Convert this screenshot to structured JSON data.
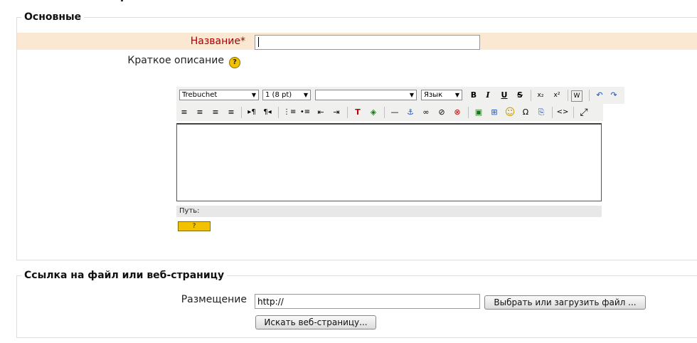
{
  "sections": {
    "general": {
      "legend": "Основные"
    },
    "link": {
      "legend": "Ссылка на файл или веб-страницу"
    }
  },
  "form": {
    "name_label": "Название",
    "required_mark": "*",
    "name_value": "",
    "summary_label": "Краткое описание",
    "location_label": "Размещение",
    "location_value": "http://"
  },
  "editor": {
    "font_family": "Trebuchet",
    "font_size": "1 (8 pt)",
    "heading": "",
    "language": "Язык",
    "path_label": "Путь:",
    "toolbar1": [
      {
        "name": "bold-icon",
        "glyph": "B"
      },
      {
        "name": "italic-icon",
        "glyph": "I"
      },
      {
        "name": "underline-icon",
        "glyph": "U"
      },
      {
        "name": "strikethrough-icon",
        "glyph": "S"
      },
      {
        "name": "subscript-icon",
        "glyph": "x₂"
      },
      {
        "name": "superscript-icon",
        "glyph": "x²"
      },
      {
        "name": "paste-word-icon",
        "glyph": "W"
      },
      {
        "name": "undo-icon",
        "glyph": "↶"
      },
      {
        "name": "redo-icon",
        "glyph": "↷"
      }
    ],
    "toolbar2": [
      {
        "name": "align-left-icon",
        "glyph": "≡"
      },
      {
        "name": "align-center-icon",
        "glyph": "≡"
      },
      {
        "name": "align-right-icon",
        "glyph": "≡"
      },
      {
        "name": "justify-icon",
        "glyph": "≡"
      },
      {
        "name": "ltr-icon",
        "glyph": "▸¶"
      },
      {
        "name": "rtl-icon",
        "glyph": "¶◂"
      },
      {
        "name": "ordered-list-icon",
        "glyph": "⋮≡"
      },
      {
        "name": "unordered-list-icon",
        "glyph": "•≡"
      },
      {
        "name": "outdent-icon",
        "glyph": "⇤"
      },
      {
        "name": "indent-icon",
        "glyph": "⇥"
      },
      {
        "name": "text-color-icon",
        "glyph": "T"
      },
      {
        "name": "bg-color-icon",
        "glyph": "◈"
      },
      {
        "name": "horizontal-rule-icon",
        "glyph": "—"
      },
      {
        "name": "anchor-icon",
        "glyph": "⚓"
      },
      {
        "name": "link-icon",
        "glyph": "∞"
      },
      {
        "name": "unlink-icon",
        "glyph": "⊘"
      },
      {
        "name": "nolink-icon",
        "glyph": "⊗"
      },
      {
        "name": "image-icon",
        "glyph": "▣"
      },
      {
        "name": "table-icon",
        "glyph": "⊞"
      },
      {
        "name": "smiley-icon",
        "glyph": "☺"
      },
      {
        "name": "special-char-icon",
        "glyph": "Ω"
      },
      {
        "name": "search-replace-icon",
        "glyph": "⎘"
      },
      {
        "name": "html-source-icon",
        "glyph": "<>"
      },
      {
        "name": "fullscreen-icon",
        "glyph": "⤢"
      }
    ],
    "help_glyph": "?",
    "keyboard_glyph": "?"
  },
  "buttons": {
    "choose_file": "Выбрать или загрузить файл ...",
    "search_web": "Искать веб-страницу..."
  },
  "colors": {
    "required_row_bg": "#fbe8d2",
    "required_label": "#aa0000",
    "help_icon": "#f2c200"
  }
}
